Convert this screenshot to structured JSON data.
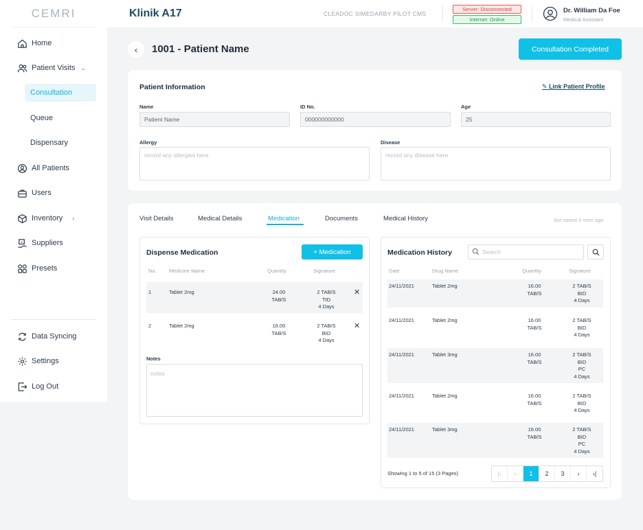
{
  "logo": "CEMRI",
  "header": {
    "clinic": "Klinik A17",
    "cms": "CLEADOC SIMEDARBY PILOT CMS",
    "server_status": "Server: Disconnected",
    "internet_status": "Internet: Online",
    "user_name": "Dr. William Da Foe",
    "user_role": "Medical Assistant"
  },
  "sidebar": {
    "items": [
      {
        "label": "Home",
        "icon": "home-icon"
      },
      {
        "label": "Patient Visits",
        "icon": "users-icon"
      },
      {
        "label": "Consultation"
      },
      {
        "label": "Queue"
      },
      {
        "label": "Dispensary"
      },
      {
        "label": "All Patients",
        "icon": "user-circle-icon"
      },
      {
        "label": "Users",
        "icon": "briefcase-icon"
      },
      {
        "label": "Inventory",
        "icon": "box-icon"
      },
      {
        "label": "Suppliers",
        "icon": "truck-icon"
      },
      {
        "label": "Presets",
        "icon": "grid-icon"
      },
      {
        "label": "Data Syncing",
        "icon": "sync-icon"
      },
      {
        "label": "Settings",
        "icon": "gear-icon"
      },
      {
        "label": "Log Out",
        "icon": "logout-icon"
      }
    ]
  },
  "page": {
    "title": "1001 - Patient Name",
    "complete_button": "Consultation Completed"
  },
  "patient_info": {
    "title": "Patient Information",
    "link": "Link Patient Profile",
    "name_label": "Name",
    "name_value": "Patient Name",
    "id_label": "ID No.",
    "id_value": "000000000000",
    "age_label": "Age",
    "age_value": "25",
    "allergy_label": "Allergy",
    "allergy_placeholder": "record any allergies here",
    "disease_label": "Disease",
    "disease_placeholder": "record any disease here"
  },
  "tabs": [
    "Visit Details",
    "Medical Details",
    "Medication",
    "Documents",
    "Medical History"
  ],
  "active_tab": "Medication",
  "last_saved": "last saved 3 mins ago",
  "dispense": {
    "title": "Dispense Medication",
    "add_button": "+  Medication",
    "headers": [
      "No.",
      "Medicine Name",
      "Quantity",
      "Signature"
    ],
    "rows": [
      {
        "no": "1",
        "name": "Tablet 2mg",
        "qty": [
          "24.00",
          "TAB/S"
        ],
        "sig": [
          "2 TAB/S",
          "TID",
          "4 Days"
        ]
      },
      {
        "no": "2",
        "name": "Tablet 2mg",
        "qty": [
          "16.00",
          "TAB/S"
        ],
        "sig": [
          "2 TAB/S",
          "BID",
          "4 Days"
        ]
      }
    ],
    "notes_label": "Notes",
    "notes_placeholder": "notes"
  },
  "history": {
    "title": "Medication History",
    "search_placeholder": "Search",
    "headers": [
      "Date",
      "Drug Name",
      "Quantity",
      "Signature"
    ],
    "rows": [
      {
        "date": "24/11/2021",
        "name": "Tablet 2mg",
        "qty": [
          "16.00",
          "TAB/S"
        ],
        "sig": [
          "2 TAB/S",
          "BID",
          "4 Days"
        ]
      },
      {
        "date": "24/11/2021",
        "name": "Tablet 2mg",
        "qty": [
          "16.00",
          "TAB/S"
        ],
        "sig": [
          "2 TAB/S",
          "BID",
          "4 Days"
        ]
      },
      {
        "date": "24/11/2021",
        "name": "Tablet 3mg",
        "qty": [
          "16.00",
          "TAB/S"
        ],
        "sig": [
          "2 TAB/S",
          "BID",
          "PC",
          "4 Days"
        ]
      },
      {
        "date": "24/11/2021",
        "name": "Tablet 2mg",
        "qty": [
          "16.00",
          "TAB/S"
        ],
        "sig": [
          "2 TAB/S",
          "BID",
          "4 Days"
        ]
      },
      {
        "date": "24/11/2021",
        "name": "Tablet 3mg",
        "qty": [
          "16.00",
          "TAB/S"
        ],
        "sig": [
          "2 TAB/S",
          "BID",
          "PC",
          "4 Days"
        ]
      }
    ],
    "showing": "Showing 1 to 5 of 15 (3 Pages)",
    "pages": [
      "1",
      "2",
      "3"
    ],
    "current_page": "1"
  }
}
